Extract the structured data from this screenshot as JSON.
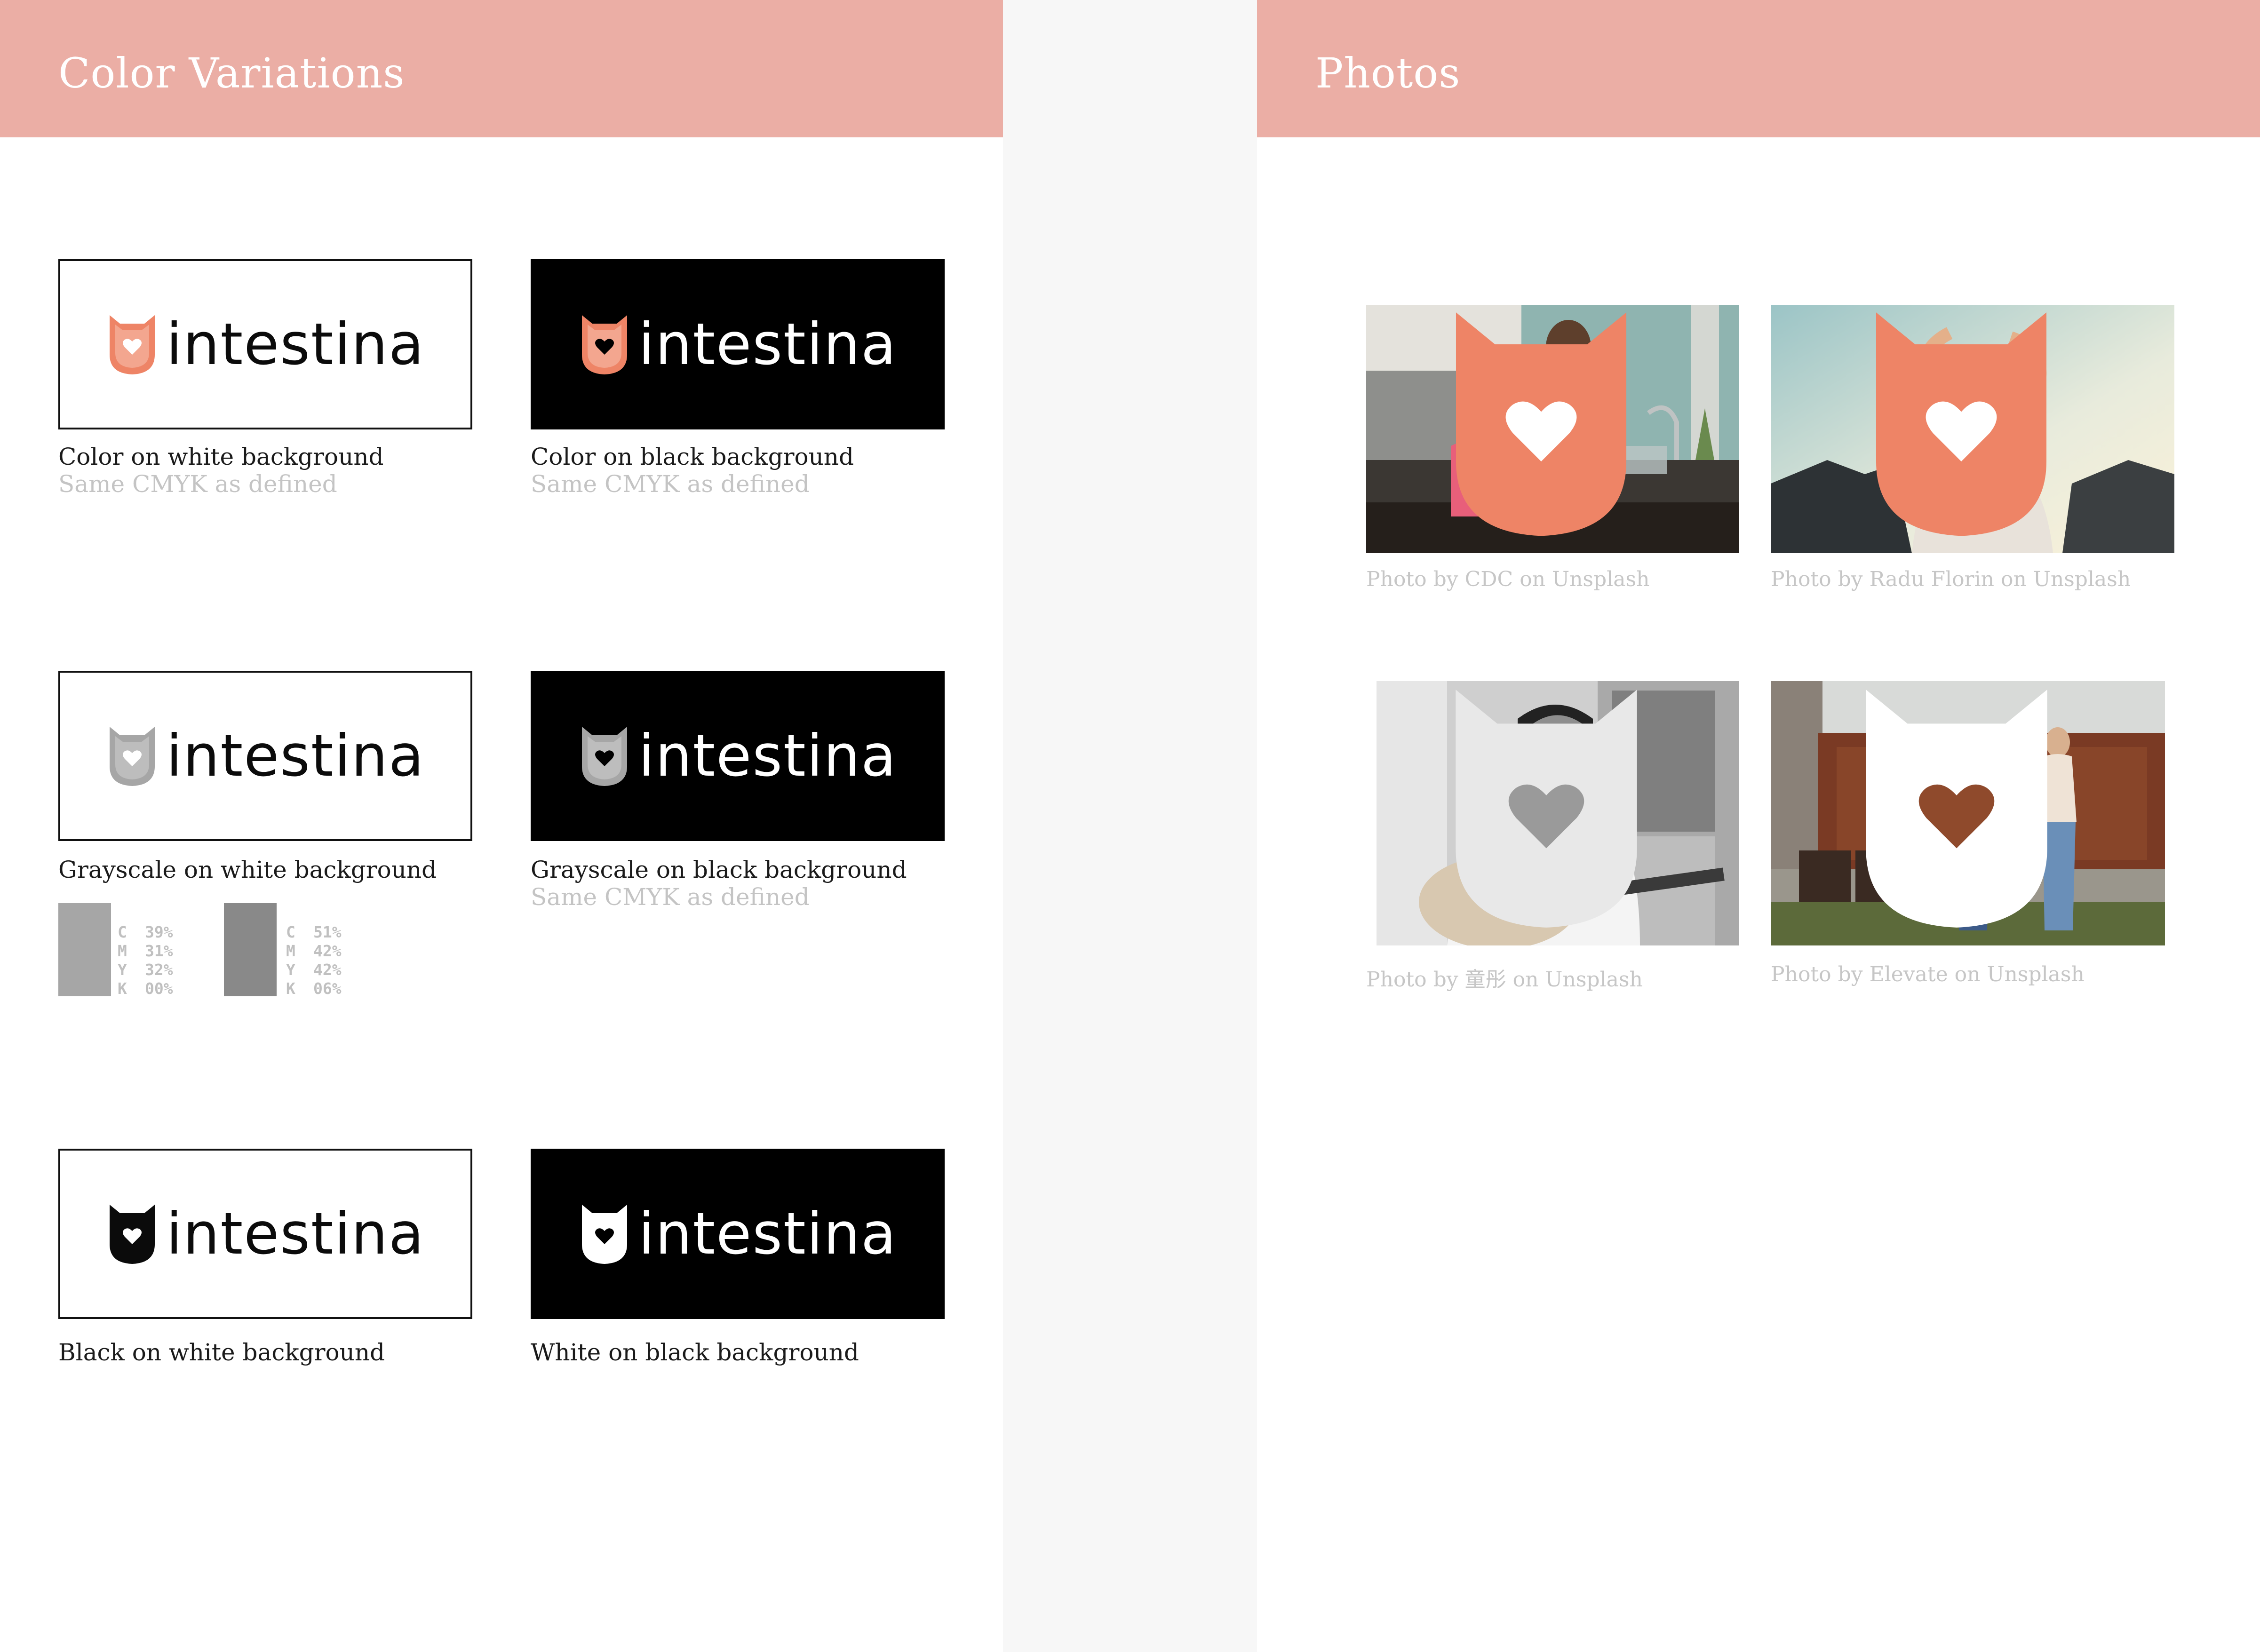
{
  "left": {
    "title": "Color Variations",
    "variations": [
      {
        "caption": "Color on white background",
        "subcaption": "Same CMYK as defined",
        "wordmark": "intestina",
        "icon": "shield-heart-icon",
        "icon_color": "#ee8466",
        "box": "white"
      },
      {
        "caption": "Color on black background",
        "subcaption": "Same CMYK as defined",
        "wordmark": "intestina",
        "icon": "shield-heart-icon",
        "icon_color": "#ee8466",
        "box": "black"
      },
      {
        "caption": "Grayscale on white background",
        "wordmark": "intestina",
        "icon": "shield-heart-icon",
        "icon_color": "#a6a6a6",
        "box": "white"
      },
      {
        "caption": "Grayscale on black background",
        "subcaption": "Same CMYK as defined",
        "wordmark": "intestina",
        "icon": "shield-heart-icon",
        "icon_color": "#a6a6a6",
        "box": "black"
      },
      {
        "caption": "Black on white background",
        "wordmark": "intestina",
        "icon": "shield-heart-icon",
        "icon_color": "#0b0b0b",
        "box": "white"
      },
      {
        "caption": "White on black background",
        "wordmark": "intestina",
        "icon": "shield-heart-icon",
        "icon_color": "#ffffff",
        "box": "black"
      }
    ],
    "swatches": [
      {
        "color": "#a6a6a6",
        "c": "39%",
        "m": "31%",
        "y": "32%",
        "k": "00%"
      },
      {
        "color": "#898989",
        "c": "51%",
        "m": "42%",
        "y": "42%",
        "k": "06%"
      }
    ],
    "cmyk_letters": [
      "C",
      "M",
      "Y",
      "K"
    ]
  },
  "right": {
    "title": "Photos",
    "photos": [
      {
        "credit": "Photo by CDC on Unsplash",
        "subject": "father and daughter washing hands at kitchen sink"
      },
      {
        "credit": "Photo by Radu Florin on Unsplash",
        "subject": "woman with glasses stretching in sunlight"
      },
      {
        "credit": "Photo by 童彤 on Unsplash",
        "subject": "man laughing playing guitar (black and white)"
      },
      {
        "credit": "Photo by Elevate on Unsplash",
        "subject": "two women standing on rooftop terrace"
      }
    ]
  },
  "colors": {
    "accent": "#ebaea5",
    "brand": "#ee8466",
    "page": "#f7f7f7"
  }
}
